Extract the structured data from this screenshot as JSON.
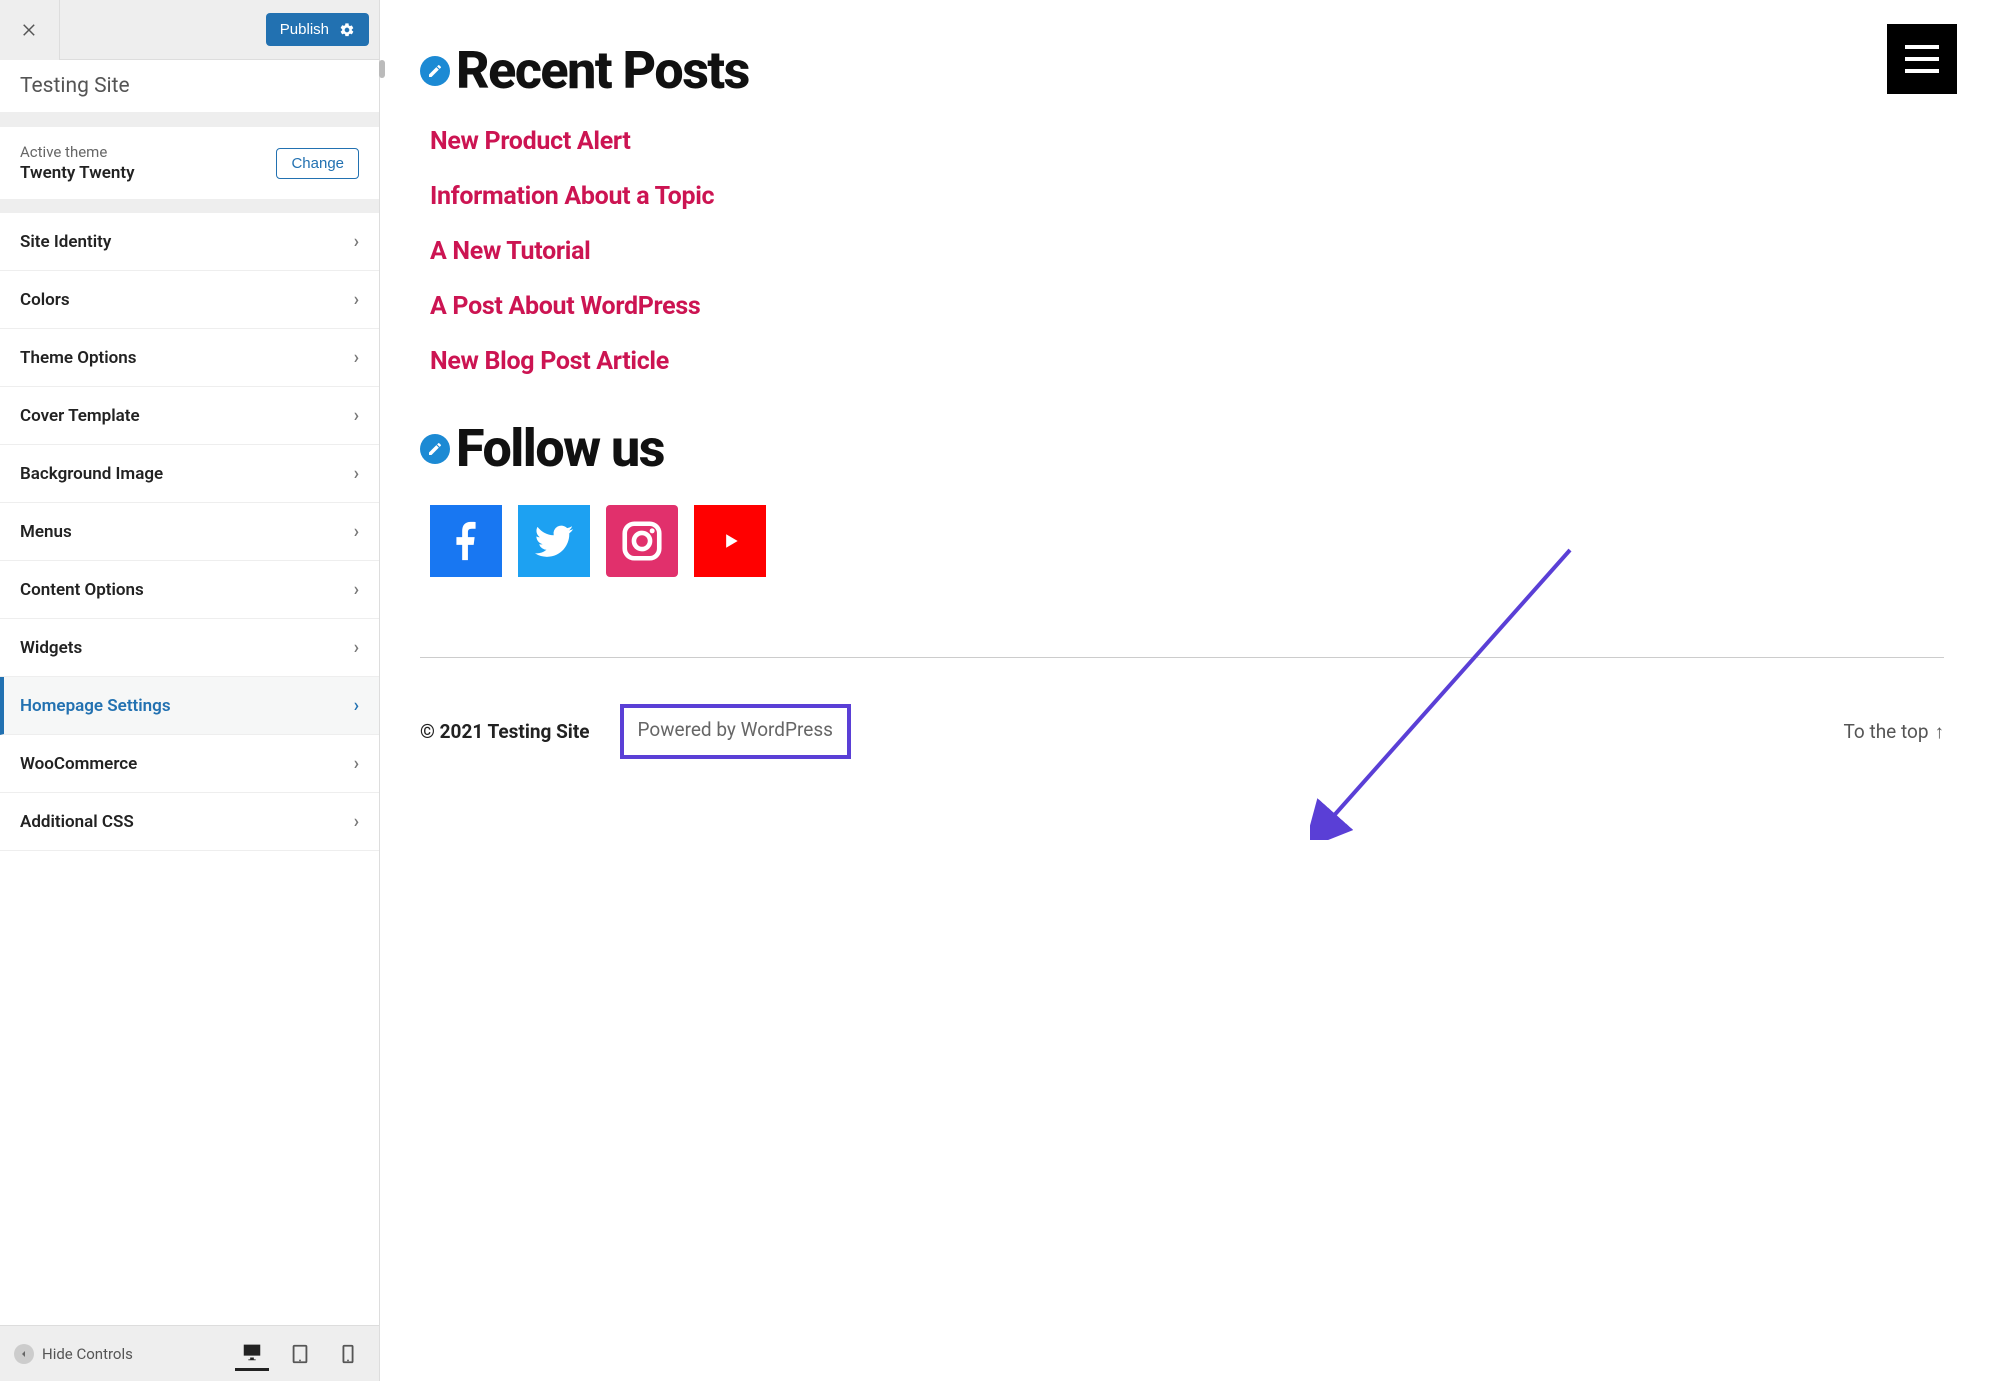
{
  "topbar": {
    "publish_label": "Publish"
  },
  "site": {
    "title": "Testing Site"
  },
  "theme": {
    "label": "Active theme",
    "name": "Twenty Twenty",
    "change_label": "Change"
  },
  "panels": [
    {
      "label": "Site Identity",
      "active": false
    },
    {
      "label": "Colors",
      "active": false
    },
    {
      "label": "Theme Options",
      "active": false
    },
    {
      "label": "Cover Template",
      "active": false
    },
    {
      "label": "Background Image",
      "active": false
    },
    {
      "label": "Menus",
      "active": false
    },
    {
      "label": "Content Options",
      "active": false
    },
    {
      "label": "Widgets",
      "active": false
    },
    {
      "label": "Homepage Settings",
      "active": true
    },
    {
      "label": "WooCommerce",
      "active": false
    },
    {
      "label": "Additional CSS",
      "active": false
    }
  ],
  "footerbar": {
    "hide_label": "Hide Controls"
  },
  "preview": {
    "recent_posts": {
      "heading": "Recent Posts",
      "items": [
        "New Product Alert",
        "Information About a Topic",
        "A New Tutorial",
        "A Post About WordPress",
        "New Blog Post Article"
      ]
    },
    "follow": {
      "heading": "Follow us"
    },
    "footer": {
      "copyright": "© 2021 Testing Site",
      "powered": "Powered by WordPress",
      "totop": "To the top"
    }
  }
}
